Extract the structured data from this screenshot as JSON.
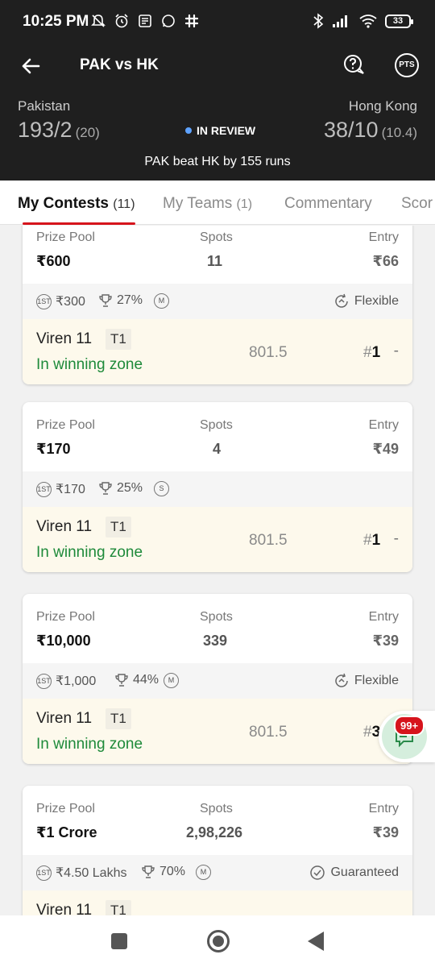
{
  "status_bar": {
    "time": "10:25 PM",
    "battery": "33"
  },
  "header": {
    "back_icon": "arrow-left-icon",
    "title": "PAK vs HK",
    "help_icon": "question-chat-icon",
    "pts_label": "PTS"
  },
  "scoreboard": {
    "team1": {
      "name": "Pakistan",
      "score": "193/2",
      "overs": "(20)"
    },
    "team2": {
      "name": "Hong Kong",
      "score": "38/10",
      "overs": "(10.4)"
    },
    "status": "IN REVIEW",
    "status_color": "#5ea2ff",
    "result": "PAK beat HK by 155 runs"
  },
  "tabs": [
    {
      "label": "My Contests",
      "count": "(11)",
      "active": true
    },
    {
      "label": "My Teams",
      "count": "(1)",
      "active": false
    },
    {
      "label": "Commentary",
      "count": "",
      "active": false
    },
    {
      "label": "Scor",
      "count": "",
      "active": false
    }
  ],
  "labels": {
    "prize_pool": "Prize Pool",
    "spots": "Spots",
    "entry": "Entry"
  },
  "contests": [
    {
      "prize_pool": "₹600",
      "spots": "11",
      "entry": "₹66",
      "first_prize": "₹300",
      "win_pct": "27%",
      "type_badge": "M",
      "flag": "Flexible",
      "flag_icon": "flexible-icon",
      "team": "Viren 11",
      "team_tag": "T1",
      "zone": "In winning zone",
      "points": "801.5",
      "rank_prefix": "#",
      "rank": "1",
      "change": "-"
    },
    {
      "prize_pool": "₹170",
      "spots": "4",
      "entry": "₹49",
      "first_prize": "₹170",
      "win_pct": "25%",
      "type_badge": "S",
      "flag": "",
      "flag_icon": "",
      "team": "Viren 11",
      "team_tag": "T1",
      "zone": "In winning zone",
      "points": "801.5",
      "rank_prefix": "#",
      "rank": "1",
      "change": "-"
    },
    {
      "prize_pool": "₹10,000",
      "spots": "339",
      "entry": "₹39",
      "first_prize": "₹1,000",
      "win_pct": "44%",
      "type_badge": "M",
      "flag": "Flexible",
      "flag_icon": "flexible-icon",
      "team": "Viren 11",
      "team_tag": "T1",
      "zone": "In winning zone",
      "points": "801.5",
      "rank_prefix": "#",
      "rank": "3",
      "change": ""
    },
    {
      "prize_pool": "₹1 Crore",
      "spots": "2,98,226",
      "entry": "₹39",
      "first_prize": "₹4.50 Lakhs",
      "win_pct": "70%",
      "type_badge": "M",
      "flag": "Guaranteed",
      "flag_icon": "check-circle-icon",
      "team": "Viren 11",
      "team_tag": "T1",
      "zone": "",
      "points": "",
      "rank_prefix": "",
      "rank": "",
      "change": ""
    }
  ],
  "chat_badge": "99+"
}
